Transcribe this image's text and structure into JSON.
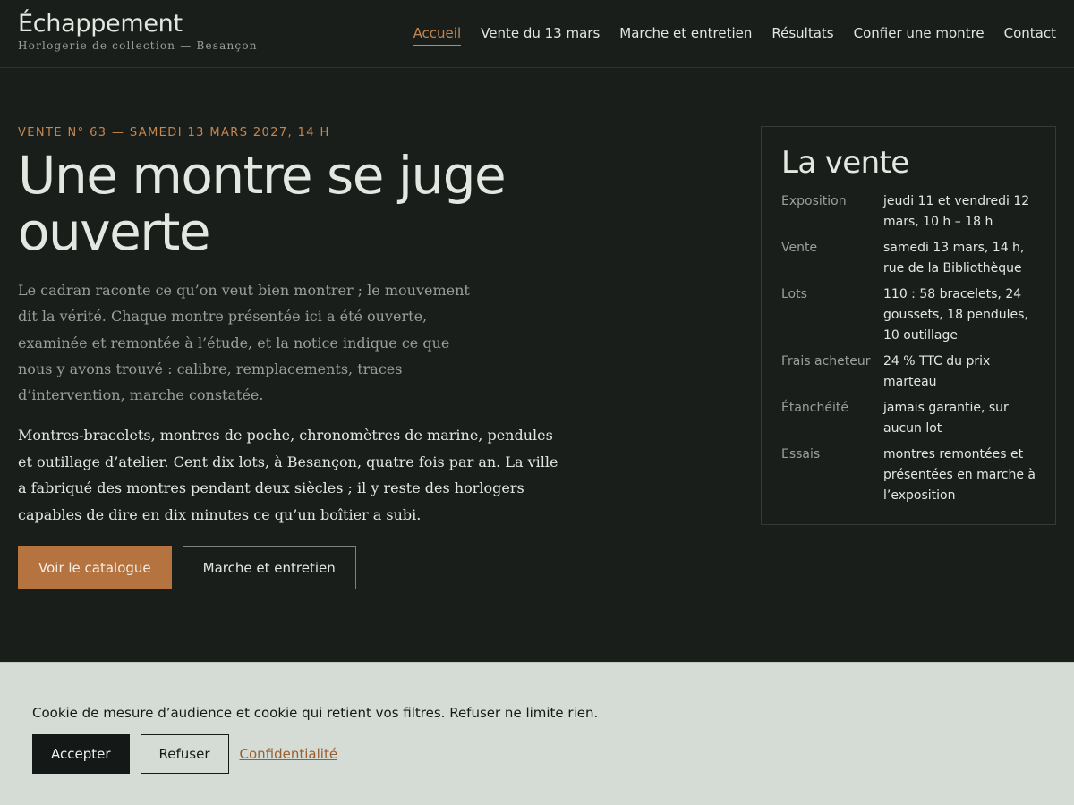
{
  "brand": {
    "name": "Échappement",
    "tagline": "Horlogerie de collection — Besançon"
  },
  "nav": {
    "items": [
      {
        "label": "Accueil",
        "active": true
      },
      {
        "label": "Vente du 13 mars"
      },
      {
        "label": "Marche et entretien"
      },
      {
        "label": "Résultats"
      },
      {
        "label": "Confier une montre"
      },
      {
        "label": "Contact"
      }
    ]
  },
  "hero": {
    "eyebrow": "Vente n° 63 — samedi 13 mars 2027, 14 h",
    "title": "Une montre se juge ouverte",
    "lead": "Le cadran raconte ce qu’on veut bien montrer ; le mouvement dit la vérité. Chaque montre présentée ici a été ouverte, examinée et remontée à l’étude, et la notice indique ce que nous y avons trouvé : calibre, remplacements, traces d’intervention, marche constatée.",
    "body": "Montres-bracelets, montres de poche, chronomètres de marine, pendules et outillage d’atelier. Cent dix lots, à Besançon, quatre fois par an. La ville a fabriqué des montres pendant deux siècles ; il y reste des horlogers capables de dire en dix minutes ce qu’un boîtier a subi.",
    "cta_primary": "Voir le catalogue",
    "cta_secondary": "Marche et entretien"
  },
  "sale": {
    "title": "La vente",
    "rows": [
      {
        "label": "Exposition",
        "value": "jeudi 11 et vendredi 12 mars, 10 h – 18 h"
      },
      {
        "label": "Vente",
        "value": "samedi 13 mars, 14 h, rue de la Bibliothèque"
      },
      {
        "label": "Lots",
        "value": "110 : 58 bracelets, 24 goussets, 18 pendules, 10 outillage"
      },
      {
        "label": "Frais acheteur",
        "value": "24 % TTC du prix marteau"
      },
      {
        "label": "Étanchéité",
        "value": "jamais garantie, sur aucun lot"
      },
      {
        "label": "Essais",
        "value": "montres remontées et présentées en marche à l’exposition"
      }
    ]
  },
  "cookie": {
    "text": "Cookie de mesure d’audience et cookie qui retient vos filtres. Refuser ne limite rien.",
    "accept": "Accepter",
    "refuse": "Refuser",
    "privacy": "Confidentialité"
  },
  "colors": {
    "background": "#1a1e1b",
    "accent": "#c58650",
    "button": "#b4733f",
    "cookie_bar": "#d5dbd5"
  }
}
